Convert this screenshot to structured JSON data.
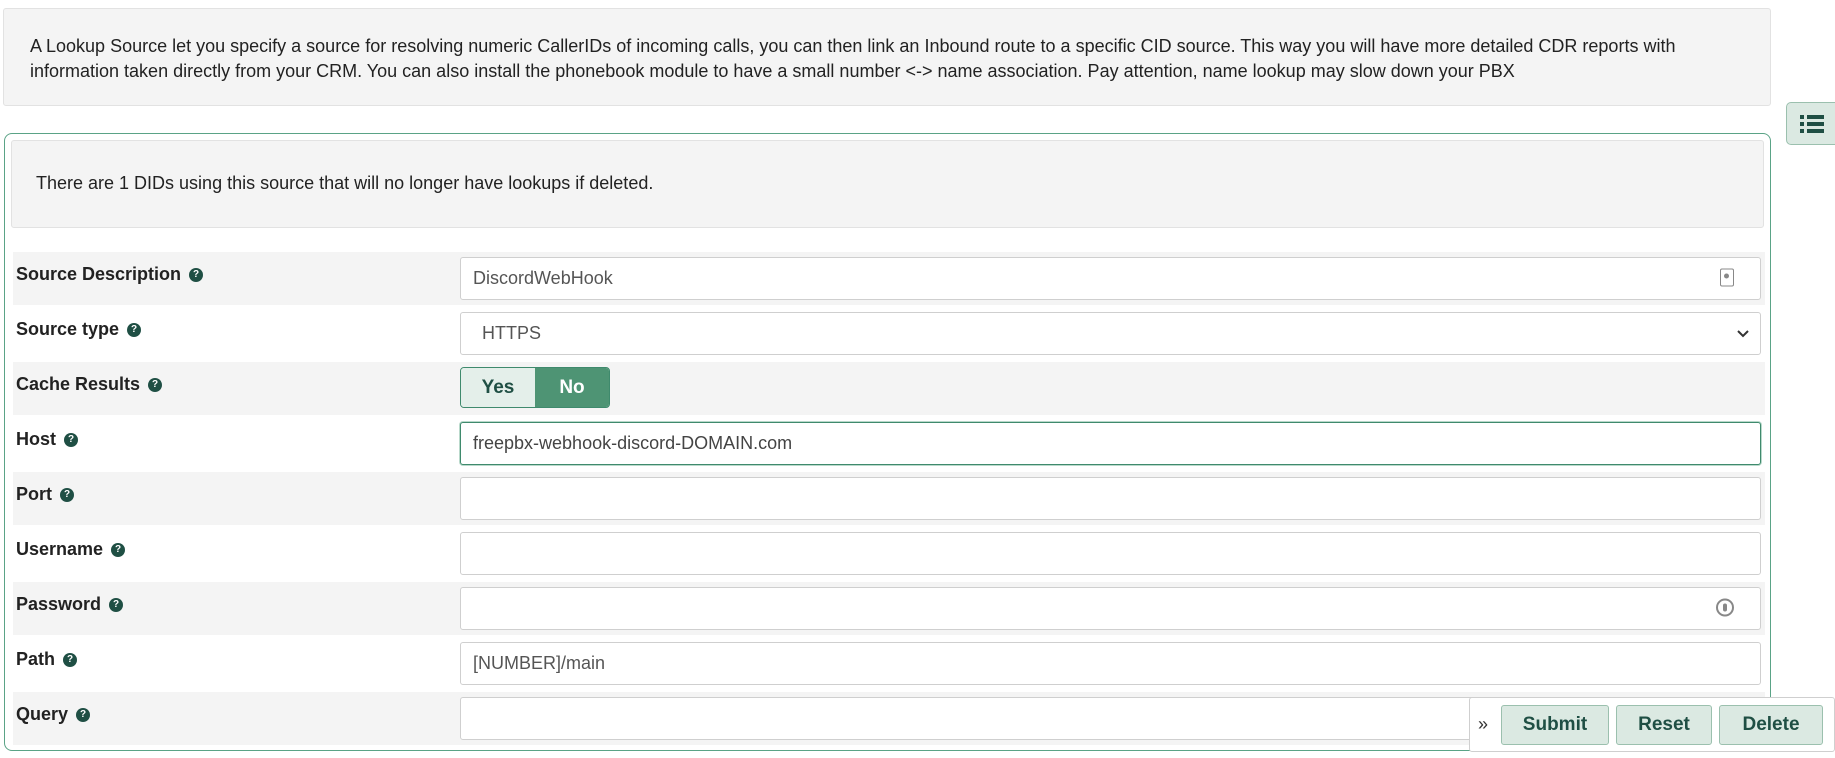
{
  "intro": {
    "text": "A Lookup Source let you specify a source for resolving numeric CallerIDs of incoming calls, you can then link an Inbound route to a specific CID source. This way you will have more detailed CDR reports with information taken directly from your CRM. You can also install the phonebook module to have a small number <-> name association. Pay attention, name lookup may slow down your PBX"
  },
  "warning": {
    "text": "There are 1 DIDs using this source that will no longer have lookups if deleted."
  },
  "form": {
    "source_description": {
      "label": "Source Description",
      "value": "DiscordWebHook",
      "trail_icon": "contact-card-icon"
    },
    "source_type": {
      "label": "Source type",
      "value": "HTTPS"
    },
    "cache_results": {
      "label": "Cache Results",
      "yes": "Yes",
      "no": "No",
      "selected": "No"
    },
    "host": {
      "label": "Host",
      "value": "freepbx-webhook-discord-DOMAIN.com"
    },
    "port": {
      "label": "Port",
      "value": ""
    },
    "username": {
      "label": "Username",
      "value": ""
    },
    "password": {
      "label": "Password",
      "value": "",
      "trail_icon": "key-icon"
    },
    "path": {
      "label": "Path",
      "value": "[NUMBER]/main"
    },
    "query": {
      "label": "Query",
      "value": ""
    }
  },
  "help_glyph": "?",
  "actions": {
    "expand_glyph": "»",
    "submit": "Submit",
    "reset": "Reset",
    "delete": "Delete"
  },
  "icons": {
    "help": "question-circle-icon",
    "side_toggle": "list-icon",
    "expand": "double-chevron-right-icon"
  },
  "colors": {
    "accent": "#4e9474",
    "accent_dark": "#1f4f44",
    "button_bg": "#dbe9e2",
    "panel_border": "#5aa386"
  }
}
